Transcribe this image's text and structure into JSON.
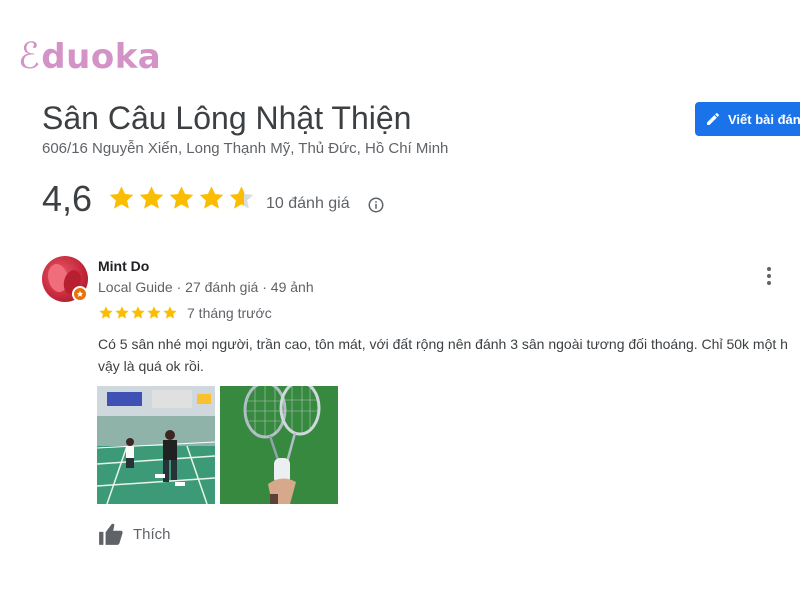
{
  "brand": {
    "logo_mark": "ℰ",
    "logo_text": "duoka",
    "color": "#d393c6"
  },
  "place": {
    "name": "Sân Câu Lông Nhật Thiện",
    "address": "606/16 Nguyễn Xiển, Long Thạnh Mỹ, Thủ Đức, Hồ Chí Minh",
    "write_review_label": "Viết bài đánh giá",
    "rating": "4,6",
    "rating_value": 4.6,
    "review_count_label": "10 đánh giá"
  },
  "review": {
    "author": "Mint Do",
    "author_meta": "Local Guide · 27 đánh giá · 49 ảnh",
    "stars": 5,
    "time": "7 tháng trước",
    "text": "Có 5 sân nhé mọi người, trần cao, tôn mát, với đất rộng nên đánh 3 sân ngoài tương đối thoáng. Chỉ 50k một h vậy là quá ok rồi.",
    "photos": [
      "badminton-court-photo",
      "badminton-rackets-photo"
    ],
    "like_label": "Thích"
  },
  "colors": {
    "star": "#fbbc04",
    "star_empty": "#dadce0",
    "accent": "#1a73e8",
    "badge": "#e8710a"
  }
}
